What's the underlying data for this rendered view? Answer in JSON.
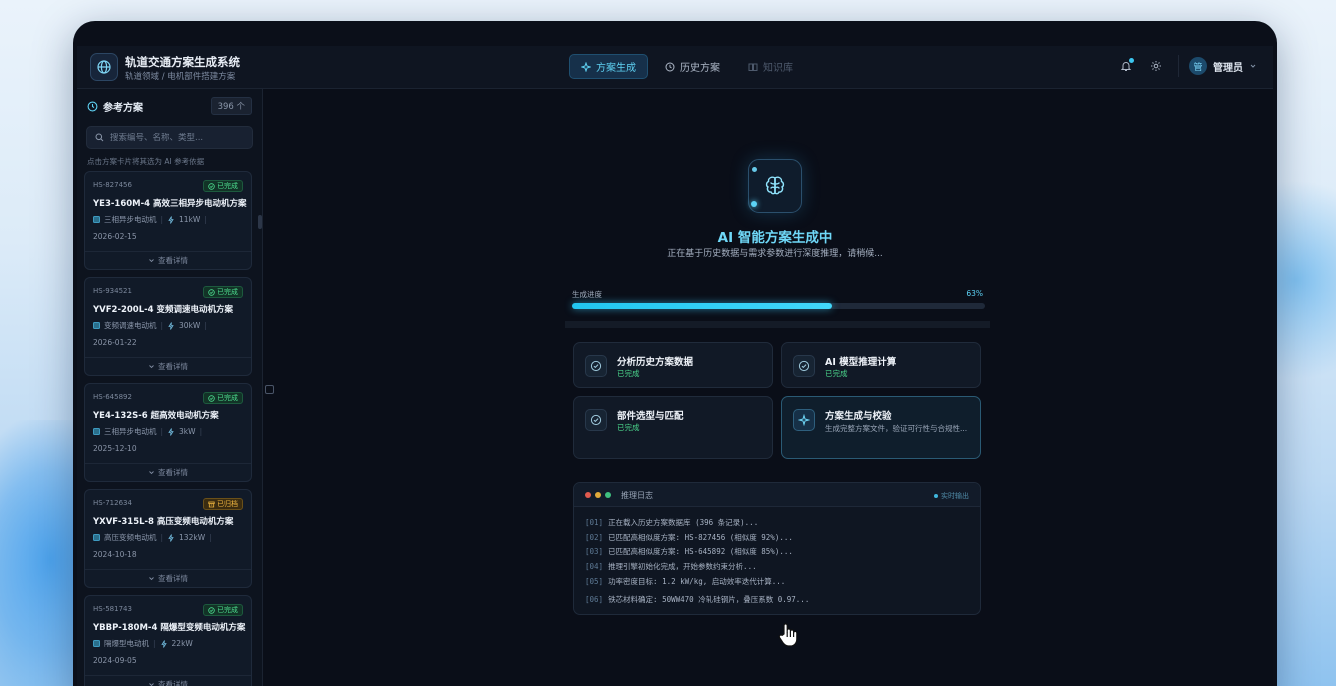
{
  "app": {
    "title": "轨道交通方案生成系统",
    "subtitle": "轨道领域 / 电机部件搭建方案"
  },
  "nav": {
    "tabs": [
      {
        "label": "方案生成",
        "icon": "sparkle-icon",
        "state": "active"
      },
      {
        "label": "历史方案",
        "icon": "clock-icon",
        "state": "normal"
      },
      {
        "label": "知识库",
        "icon": "book-icon",
        "state": "disabled"
      }
    ]
  },
  "header_right": {
    "user_initial": "管",
    "user_name": "管理员"
  },
  "sidebar": {
    "title": "参考方案",
    "count": "396 个",
    "search_placeholder": "搜索编号、名称、类型...",
    "hint": "点击方案卡片将其选为 AI 参考依据",
    "detail_label": "查看详情",
    "cards": [
      {
        "code": "HS-827456",
        "status": "已完成",
        "status_type": "done",
        "name": "YE3-160M-4 高效三相异步电动机方案",
        "type": "三相异步电动机",
        "power": "11kW",
        "date": "2026-02-15"
      },
      {
        "code": "HS-934521",
        "status": "已完成",
        "status_type": "done",
        "name": "YVF2-200L-4 变频调速电动机方案",
        "type": "变频调速电动机",
        "power": "30kW",
        "date": "2026-01-22"
      },
      {
        "code": "HS-645892",
        "status": "已完成",
        "status_type": "done",
        "name": "YE4-132S-6 超高效电动机方案",
        "type": "三相异步电动机",
        "power": "3kW",
        "date": "2025-12-10"
      },
      {
        "code": "HS-712634",
        "status": "已归档",
        "status_type": "arch",
        "name": "YXVF-315L-8 高压变频电动机方案",
        "type": "高压变频电动机",
        "power": "132kW",
        "date": "2024-10-18"
      },
      {
        "code": "HS-581743",
        "status": "已完成",
        "status_type": "done",
        "name": "YBBP-180M-4 隔爆型变频电动机方案",
        "type": "隔爆型电动机",
        "power": "22kW",
        "date": "2024-09-05"
      }
    ]
  },
  "main": {
    "title": "AI 智能方案生成中",
    "subtitle": "正在基于历史数据与需求参数进行深度推理，请稍候...",
    "progress_label": "生成进度",
    "progress_text": "63%",
    "progress_value": 0.63,
    "steps": [
      {
        "title": "分析历史方案数据",
        "status": "已完成",
        "state": "done"
      },
      {
        "title": "AI 模型推理计算",
        "status": "已完成",
        "state": "done"
      },
      {
        "title": "部件选型与匹配",
        "status": "已完成",
        "state": "done"
      },
      {
        "title": "方案生成与校验",
        "desc": "生成完整方案文件，验证可行性与合规性...",
        "state": "active"
      }
    ],
    "log": {
      "title": "推理日志",
      "live_label": "实时输出",
      "lines": [
        {
          "n": "[01]",
          "text": "正在载入历史方案数据库 (396 条记录)..."
        },
        {
          "n": "[02]",
          "text": "已匹配高相似度方案: HS-827456 (相似度 92%)..."
        },
        {
          "n": "[03]",
          "text": "已匹配高相似度方案: HS-645892 (相似度 85%)..."
        },
        {
          "n": "[04]",
          "text": "推理引擎初始化完成，开始参数约束分析..."
        },
        {
          "n": "[05]",
          "text": "功率密度目标: 1.2 kW/kg, 启动效率迭代计算..."
        },
        {
          "n": "[06]",
          "text": "铁芯材料确定: 50WW470 冷轧硅钢片，叠压系数 0.97..."
        }
      ]
    }
  },
  "colors": {
    "accent": "#42d8fb",
    "done_green": "#4bd68c",
    "archived_amber": "#f1b740",
    "background": "#0a0e18"
  }
}
